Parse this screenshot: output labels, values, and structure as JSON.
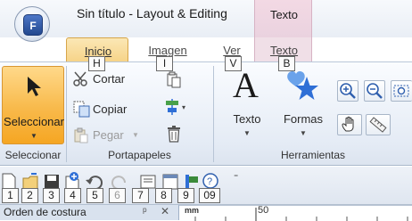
{
  "window": {
    "app_button_letter": "F",
    "title": "Sin título - Layout & Editing",
    "context_tab_group": "Texto"
  },
  "tabs": [
    {
      "label": "Inicio",
      "keytip": "H",
      "active": true
    },
    {
      "label": "Imagen",
      "keytip": "I",
      "active": false
    },
    {
      "label": "Ver",
      "keytip": "V",
      "active": false
    },
    {
      "label": "Texto",
      "keytip": "B",
      "active": false
    }
  ],
  "ribbon": {
    "groups": {
      "select": {
        "label": "Seleccionar",
        "button_label": "Seleccionar"
      },
      "clipboard": {
        "label": "Portapapeles",
        "cut": "Cortar",
        "copy": "Copiar",
        "paste": "Pegar"
      },
      "tools": {
        "label": "Herramientas",
        "text_button": "Texto",
        "shapes_button": "Formas"
      }
    }
  },
  "qat": {
    "keytips": [
      "1",
      "2",
      "3",
      "4",
      "5",
      "6",
      "7",
      "8",
      "9",
      "09"
    ]
  },
  "panel": {
    "title": "Orden de costura",
    "pin": "ᵖ",
    "close": "✕",
    "ruler_unit": "mm",
    "ruler_mark": "50"
  },
  "colors": {
    "active_tab": "#f6d387",
    "context_tab": "#ead2df",
    "select_button": "#f8b94a",
    "shapes_star": "#2f6fd6"
  }
}
